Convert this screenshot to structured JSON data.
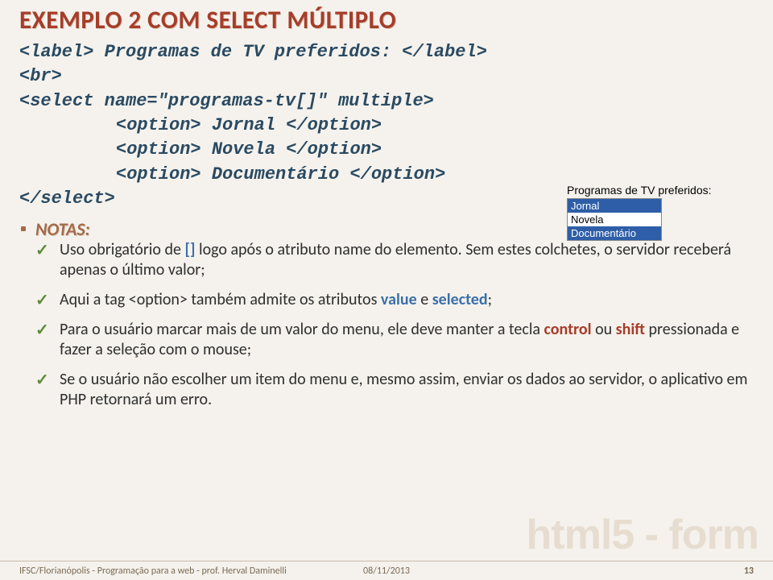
{
  "title": "EXEMPLO 2 COM SELECT MÚLTIPLO",
  "code": {
    "l1": "<label> Programas de TV preferidos: </label>",
    "l2": "<br>",
    "l3": "<select name=\"programas-tv[]\" multiple>",
    "l4": "<option> Jornal </option>",
    "l5": "<option> Novela </option>",
    "l6": "<option> Documentário </option>",
    "l7": "</select>"
  },
  "widget": {
    "label": "Programas de TV preferidos:",
    "options": [
      "Jornal",
      "Novela",
      "Documentário"
    ]
  },
  "notas": {
    "heading": "NOTAS:",
    "items": [
      {
        "pre": "Uso obrigatório de ",
        "hl": "[]",
        "mid": " logo após o atributo name do elemento. Sem estes colchetes, o servidor receberá apenas o último valor;"
      },
      {
        "pre": "Aqui a tag <option> também admite os atributos ",
        "hl1": "value",
        "and": " e ",
        "hl2": "selected",
        "post": ";"
      },
      {
        "pre": "Para o usuário marcar mais de um valor do menu, ele deve manter a tecla ",
        "hl1": "control",
        "or": " ou ",
        "hl2": "shift",
        "post": " pressionada e fazer a seleção com o mouse;"
      },
      {
        "text": "Se o usuário não escolher um item do menu e, mesmo assim, enviar os dados ao servidor, o aplicativo em PHP retornará um erro."
      }
    ]
  },
  "watermark": "html5 - form",
  "footer": {
    "left": "IFSC/Florianópolis - Programação para a web - prof. Herval Daminelli",
    "date": "08/11/2013",
    "page": "13"
  }
}
